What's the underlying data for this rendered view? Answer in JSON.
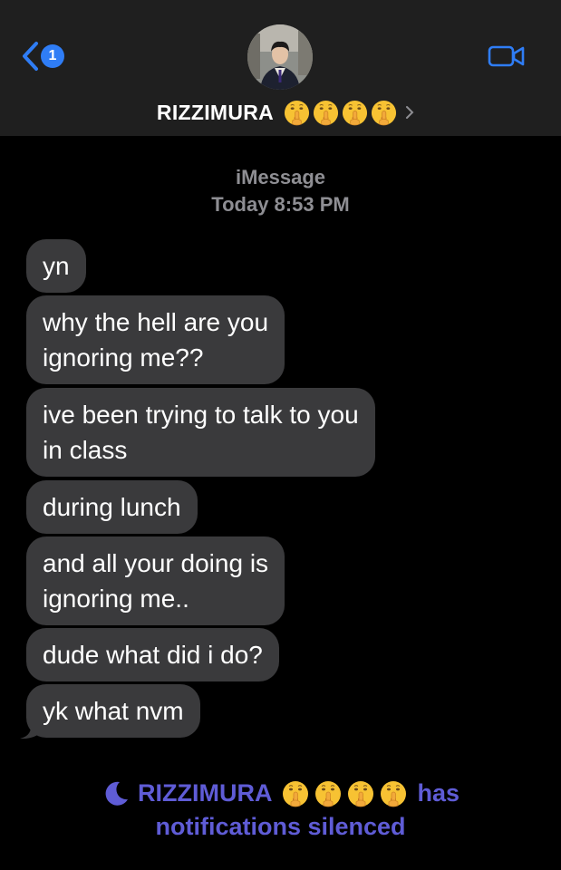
{
  "header": {
    "unread_count": "1",
    "contact_name": "RIZZIMURA",
    "contact_emoji_count": 4,
    "background": "#1f1f1f",
    "accent": "#2f7df6"
  },
  "meta": {
    "service": "iMessage",
    "timestamp": "Today 8:53 PM"
  },
  "messages": [
    {
      "text": "yn"
    },
    {
      "text": "why the hell are you\nignoring me??"
    },
    {
      "text": "ive been trying to talk to you\nin class"
    },
    {
      "text": "during lunch"
    },
    {
      "text": "and all your doing is\nignoring me.."
    },
    {
      "text": "dude what did i do?"
    },
    {
      "text": "yk what nvm"
    }
  ],
  "silenced": {
    "name": "RIZZIMURA",
    "suffix": "has",
    "line2": "notifications silenced",
    "color": "#5f5cd6"
  }
}
